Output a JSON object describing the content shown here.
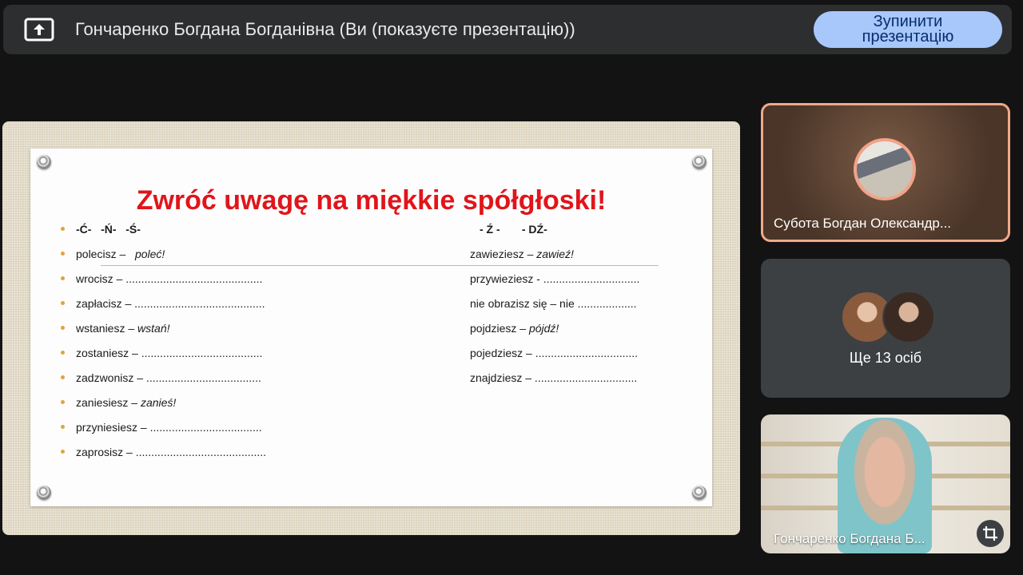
{
  "topbar": {
    "title": "Гончаренко Богдана Богданівна (Ви (показуєте презентацію))",
    "stop_button": "Зупинити презентацію",
    "present_icon": "present-to-all-icon"
  },
  "slide": {
    "title": "Zwróć uwagę na miękkie spółgłoski!",
    "left_rows": [
      {
        "text": "-Ć-   -Ń-   -Ś-",
        "answer": ""
      },
      {
        "text": "polecisz –   ",
        "answer": "poleć!"
      },
      {
        "text": "wrocisz – ............................................",
        "answer": ""
      },
      {
        "text": "zapłacisz – ..........................................",
        "answer": ""
      },
      {
        "text": "wstaniesz – ",
        "answer": "wstań!"
      },
      {
        "text": "zostaniesz – .......................................",
        "answer": ""
      },
      {
        "text": "zadzwonisz – .....................................",
        "answer": ""
      },
      {
        "text": "zaniesiesz – ",
        "answer": "zanieś!"
      },
      {
        "text": "przyniesiesz – ....................................",
        "answer": ""
      },
      {
        "text": "zaprosisz – ..........................................",
        "answer": ""
      }
    ],
    "right_rows": [
      {
        "text": "- Ź -       - DŹ-",
        "answer": ""
      },
      {
        "text": "zawieziesz – ",
        "answer": "zawieź!"
      },
      {
        "text": "przywieziesz - ...............................",
        "answer": ""
      },
      {
        "text": "nie obrazisz się – nie ...................",
        "answer": ""
      },
      {
        "text": "pojdziesz – ",
        "answer": "pójdź!"
      },
      {
        "text": "pojedziesz – .................................",
        "answer": ""
      },
      {
        "text": "znajdziesz – .................................",
        "answer": ""
      }
    ]
  },
  "participants": {
    "tile1_name": "Субота Богдан Олександр...",
    "tile2_more": "Ще 13 осіб",
    "tile3_name": "Гончаренко Богдана Б..."
  },
  "colors": {
    "accent": "#a8c7fa",
    "title_red": "#e0151b",
    "bullet_gold": "#e0a43a",
    "active_speaker_border": "#f0a989"
  }
}
